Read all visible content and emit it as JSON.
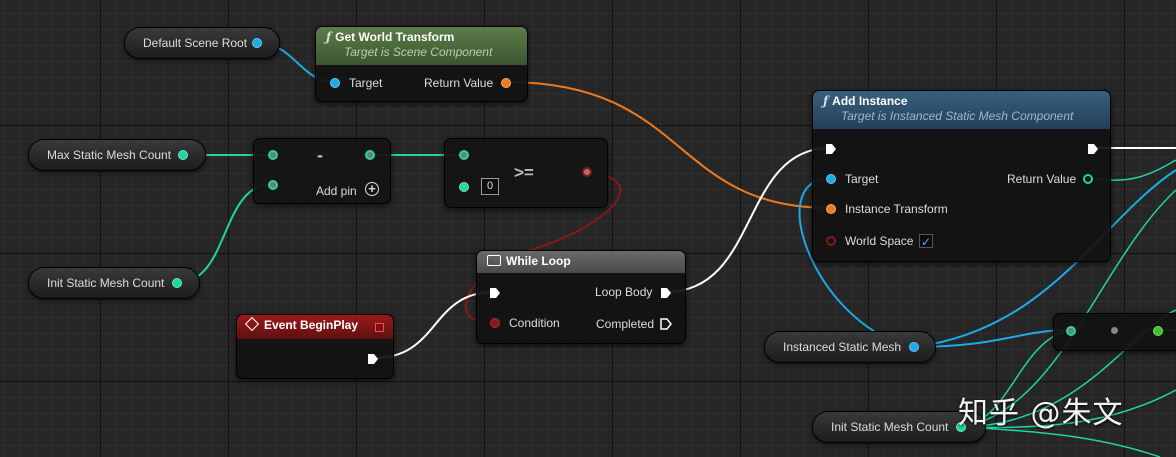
{
  "nodes": {
    "default_scene_root": {
      "label": "Default Scene Root"
    },
    "get_world_transform": {
      "title": "Get World Transform",
      "subtitle": "Target is Scene Component",
      "target": "Target",
      "return_value": "Return Value"
    },
    "max_static_mesh_count": {
      "label": "Max Static Mesh Count"
    },
    "subtract": {
      "symbol": "-",
      "add_pin": "Add pin"
    },
    "compare": {
      "symbol": ">=",
      "literal": "0"
    },
    "init_static_mesh_count_1": {
      "label": "Init Static Mesh Count"
    },
    "while_loop": {
      "title": "While Loop",
      "condition": "Condition",
      "loop_body": "Loop Body",
      "completed": "Completed"
    },
    "event_begin_play": {
      "title": "Event BeginPlay"
    },
    "add_instance": {
      "title": "Add Instance",
      "subtitle": "Target is Instanced Static Mesh Component",
      "target": "Target",
      "instance_transform": "Instance Transform",
      "world_space": "World Space",
      "return_value": "Return Value",
      "world_space_checked": "✓"
    },
    "instanced_static_mesh": {
      "label": "Instanced Static Mesh"
    },
    "init_static_mesh_count_2": {
      "label": "Init Static Mesh Count"
    }
  },
  "watermark": "知乎 @朱文",
  "colors": {
    "background": "#262626",
    "object_pin": "#1ea9e8",
    "transform_pin": "#f07a19",
    "integer_pin": "#1fd6a4",
    "bool_pin": "#8a1818",
    "exec_pin": "#ffffff",
    "function_header": "#4d6e3e",
    "add_instance_header": "#2b4a63",
    "while_loop_header": "#5a5a5a",
    "event_header": "#8a1414"
  },
  "icons": {
    "function": "function-icon",
    "loop": "loop-icon",
    "event": "event-icon",
    "add_pin": "plus-circle-icon"
  }
}
